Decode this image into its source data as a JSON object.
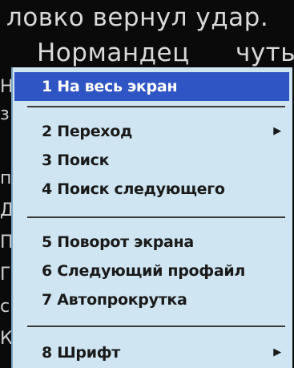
{
  "reader": {
    "line1": "ловко вернул удар.",
    "line2_left": "Нормандец",
    "line2_right": "чуть",
    "left_edge_fragments": [
      "Н",
      "з",
      "п",
      "Д",
      "П",
      "Г",
      "с",
      "К"
    ]
  },
  "menu": {
    "items": [
      {
        "label": "1 На весь экран",
        "submenu": false,
        "selected": true
      },
      {
        "label": "2 Переход",
        "submenu": true,
        "selected": false
      },
      {
        "label": "3 Поиск",
        "submenu": false,
        "selected": false
      },
      {
        "label": "4 Поиск следующего",
        "submenu": false,
        "selected": false
      },
      {
        "label": "5 Поворот экрана",
        "submenu": false,
        "selected": false
      },
      {
        "label": "6 Следующий профайл",
        "submenu": false,
        "selected": false
      },
      {
        "label": "7 Автопрокрутка",
        "submenu": false,
        "selected": false
      },
      {
        "label": "8 Шрифт",
        "submenu": true,
        "selected": false
      }
    ],
    "submenu_arrow": "▶"
  },
  "colors": {
    "menu_background": "#cfe6f2",
    "selection": "#2f55c4",
    "screen_background": "#0a0a0a"
  }
}
